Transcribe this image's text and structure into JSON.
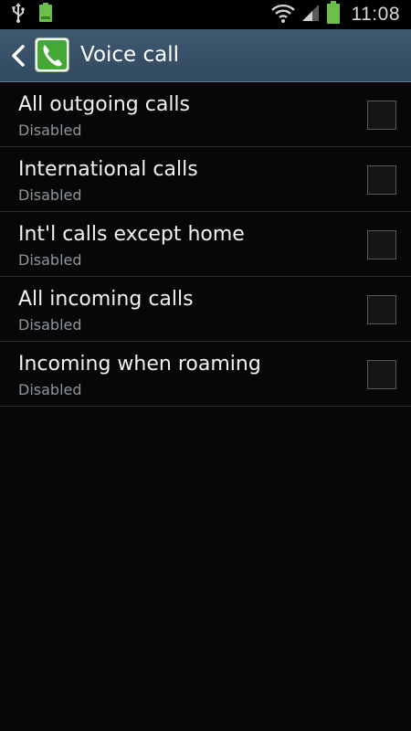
{
  "status_bar": {
    "time": "11:08",
    "icons": [
      "usb-icon",
      "battery-full-notification-icon",
      "wifi-icon",
      "signal-icon",
      "battery-icon"
    ],
    "accent_green": "#6cc04a"
  },
  "action_bar": {
    "title": "Voice call",
    "back_icon": "chevron-left-icon",
    "app_icon": "phone-icon",
    "background": "#36506a"
  },
  "items": [
    {
      "label": "All outgoing calls",
      "status": "Disabled",
      "checked": false
    },
    {
      "label": "International calls",
      "status": "Disabled",
      "checked": false
    },
    {
      "label": "Int'l calls except home",
      "status": "Disabled",
      "checked": false
    },
    {
      "label": "All incoming calls",
      "status": "Disabled",
      "checked": false
    },
    {
      "label": "Incoming when roaming",
      "status": "Disabled",
      "checked": false
    }
  ]
}
